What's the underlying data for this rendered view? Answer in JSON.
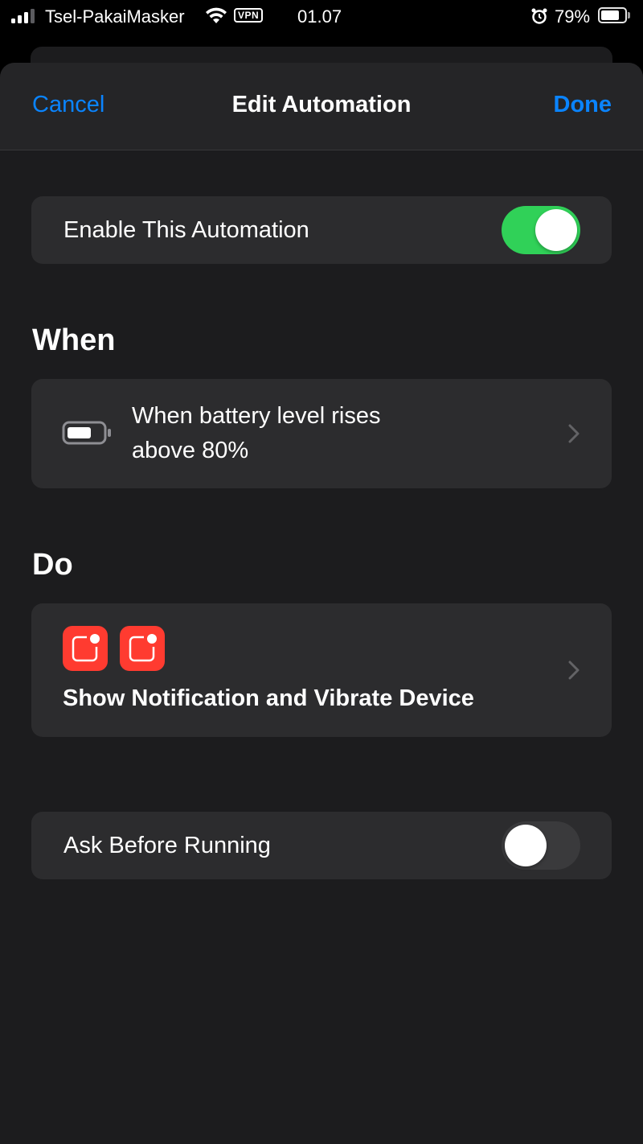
{
  "status_bar": {
    "carrier": "Tsel-PakaiMasker",
    "vpn_label": "VPN",
    "time": "01.07",
    "battery_percent": "79%",
    "battery_level": 0.79,
    "signal_bars": 3,
    "icons": [
      "signal-icon",
      "wifi-icon",
      "alarm-icon",
      "battery-icon"
    ]
  },
  "nav": {
    "cancel_label": "Cancel",
    "title": "Edit Automation",
    "done_label": "Done"
  },
  "enable": {
    "label": "Enable This Automation",
    "on": true
  },
  "when": {
    "heading": "When",
    "trigger_line1": "When battery level rises",
    "trigger_line2": "above 80%",
    "icon": "battery-icon"
  },
  "do": {
    "heading": "Do",
    "icons": [
      "notification-icon",
      "notification-icon"
    ],
    "action_text": "Show Notification and Vibrate Device"
  },
  "ask": {
    "label": "Ask Before Running",
    "on": false
  },
  "colors": {
    "accent": "#0a84ff",
    "toggle_on": "#30d158",
    "toggle_off": "#3a3a3c",
    "action_icon": "#ff3b30",
    "card": "#2c2c2e",
    "sheet": "#1c1c1e"
  }
}
